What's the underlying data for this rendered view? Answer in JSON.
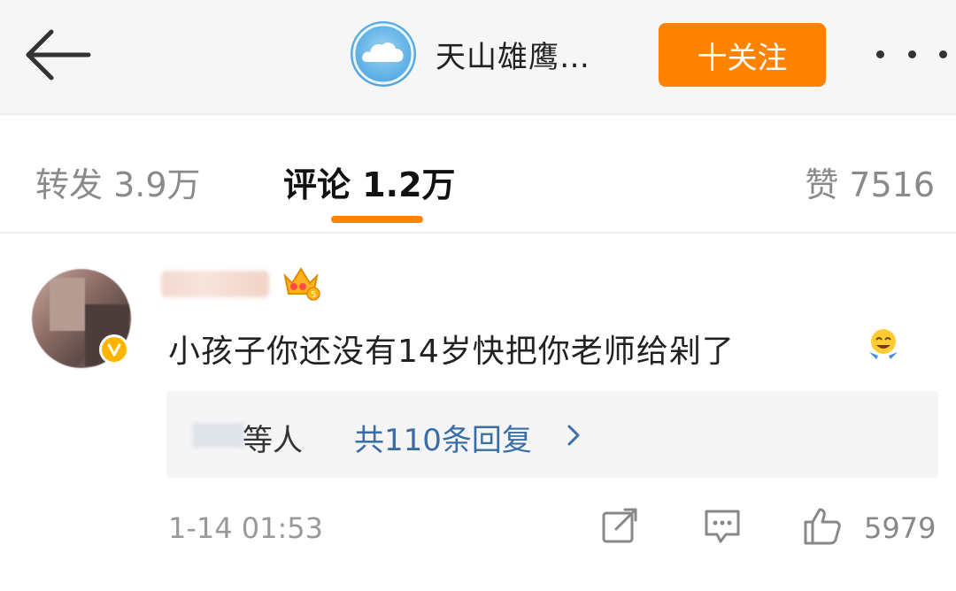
{
  "header": {
    "account_name": "天山雄鹰…",
    "follow_label": "十关注",
    "accent_color": "#ff8200"
  },
  "tabs": [
    {
      "label": "转发 3.9万",
      "active": false
    },
    {
      "label": "评论 1.2万",
      "active": true
    },
    {
      "label": "赞 7516",
      "active": false
    }
  ],
  "comment": {
    "text": "小孩子你还没有14岁快把你老师给剁了",
    "emoji": "laughing-emoji",
    "replies": {
      "suffix": "等人",
      "count_label": "共110条回复"
    },
    "timestamp": "1-14 01:53",
    "like_count": "5979"
  },
  "icons": {
    "back": "back-arrow-icon",
    "more": "more-dots-icon",
    "verified": "verified-v-badge-icon",
    "crown": "crown-level-badge-icon",
    "repost": "repost-icon",
    "reply": "comment-icon",
    "like": "thumbs-up-icon",
    "chevron": "chevron-right-icon"
  }
}
